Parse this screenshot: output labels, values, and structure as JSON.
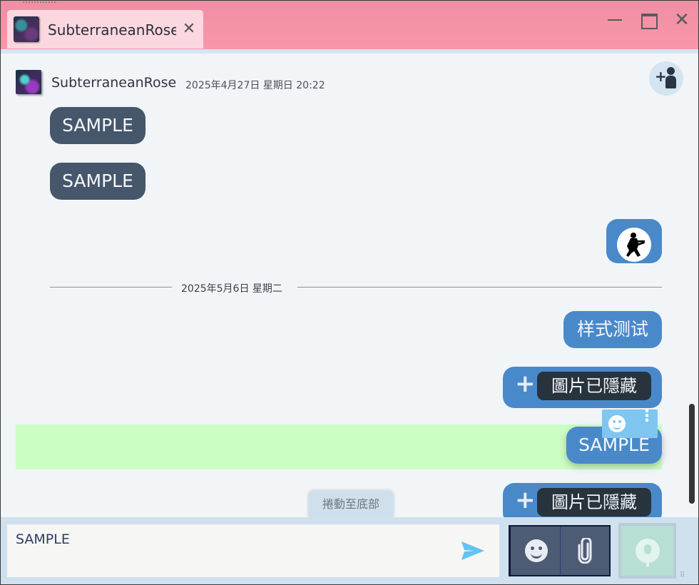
{
  "window": {
    "bleed_text": "…………",
    "tab": {
      "title": "SubterraneanRose",
      "close_label": "✕"
    },
    "controls": {
      "minimize": "minimize",
      "maximize": "maximize",
      "close_label": "✕"
    }
  },
  "chat": {
    "sender": "SubterraneanRose",
    "timestamp": "2025年4月27日 星期日 20:22",
    "add_member_icon": "add-person-icon",
    "messages": {
      "m1": "SAMPLE",
      "m2": "SAMPLE",
      "m3_sticker": "soldier-sticker",
      "m4": "样式测试",
      "m5_hidden": "圖片已隱藏",
      "m6": "SAMPLE",
      "m7_hidden": "圖片已隱藏"
    },
    "date_divider": "2025年5月6日 星期二",
    "hidden_plus": "+",
    "hover_tools": {
      "emoji_icon": "emoji-reaction-icon",
      "more_icon": "more-vert-icon",
      "more_glyph": "⋮"
    },
    "scroll_to_bottom": "捲動至底部"
  },
  "composer": {
    "input_value": "SAMPLE",
    "send_icon": "send-icon",
    "emoji_icon": "emoji-icon",
    "attach_icon": "paperclip-icon",
    "mic_icon": "microphone-icon"
  },
  "colors": {
    "titlebar": "#fa95a8",
    "tab": "#fbd7df",
    "incoming_bubble": "#46566b",
    "outgoing_bubble": "#4a89c9",
    "highlight": "#ccfec4",
    "hover_tools": "#7fc6f0"
  }
}
